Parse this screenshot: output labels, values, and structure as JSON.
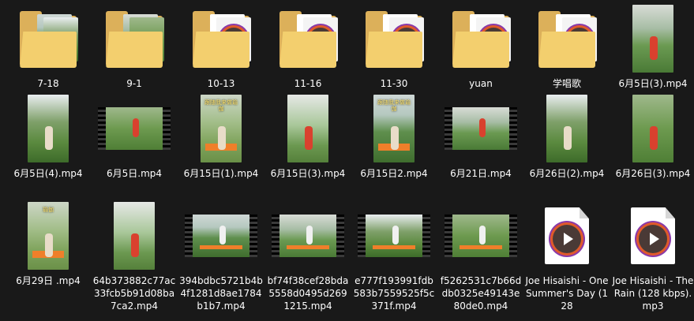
{
  "colors": {
    "background": "#191919",
    "folder": "#f3cf6e",
    "folder_back": "#dcb05a",
    "mat": "#ef7f2a",
    "play_ring_orange": "#e05a2a",
    "play_ring_purple": "#8a3aa8"
  },
  "files": [
    {
      "label": "7-18",
      "kind": "folder",
      "icon": "folder-icon"
    },
    {
      "label": "9-1",
      "kind": "folder",
      "icon": "folder-icon"
    },
    {
      "label": "10-13",
      "kind": "folder-video",
      "icon": "folder-icon"
    },
    {
      "label": "11-16",
      "kind": "folder-video",
      "icon": "folder-icon"
    },
    {
      "label": "11-30",
      "kind": "folder-video",
      "icon": "folder-icon"
    },
    {
      "label": "yuan",
      "kind": "folder-video",
      "icon": "folder-icon"
    },
    {
      "label": "学唱歌",
      "kind": "folder-video",
      "icon": "folder-icon"
    },
    {
      "label": "6月5日(3).mp4",
      "kind": "portrait",
      "icon": "video-thumbnail-icon"
    },
    {
      "label": "6月5日(4).mp4",
      "kind": "portrait",
      "icon": "video-thumbnail-icon"
    },
    {
      "label": "6月5日.mp4",
      "kind": "landscape",
      "icon": "video-thumbnail-icon"
    },
    {
      "label": "6月15日(1).mp4",
      "kind": "portrait",
      "icon": "video-thumbnail-icon",
      "overlay": "跟随我来做瑜伽"
    },
    {
      "label": "6月15日(3).mp4",
      "kind": "portrait",
      "icon": "video-thumbnail-icon"
    },
    {
      "label": "6月15日2.mp4",
      "kind": "portrait",
      "icon": "video-thumbnail-icon",
      "overlay": "跟随我来做瑜伽"
    },
    {
      "label": "6月21日.mp4",
      "kind": "landscape",
      "icon": "video-thumbnail-icon"
    },
    {
      "label": "6月26日(2).mp4",
      "kind": "portrait",
      "icon": "video-thumbnail-icon"
    },
    {
      "label": "6月26日(3).mp4",
      "kind": "portrait",
      "icon": "video-thumbnail-icon"
    },
    {
      "label": "6月29日 .mp4",
      "kind": "portrait",
      "icon": "video-thumbnail-icon",
      "overlay": "瑜伽"
    },
    {
      "label": "64b373882c77ac33fcb5b91d08ba7ca2.mp4",
      "kind": "portrait",
      "icon": "video-thumbnail-icon"
    },
    {
      "label": "394bdbc5721b4b4f1281d8ae1784b1b7.mp4",
      "kind": "landscape",
      "icon": "video-thumbnail-icon"
    },
    {
      "label": "bf74f38cef28bda5558d0495d2691215.mp4",
      "kind": "landscape",
      "icon": "video-thumbnail-icon"
    },
    {
      "label": "e777f193991fdb583b7559525f5c371f.mp4",
      "kind": "landscape",
      "icon": "video-thumbnail-icon"
    },
    {
      "label": "f5262531c7b66ddb0325e49143e80de0.mp4",
      "kind": "landscape",
      "icon": "video-thumbnail-icon"
    },
    {
      "label": "Joe Hisaishi - One Summer's Day (128",
      "kind": "audio",
      "icon": "media-player-icon"
    },
    {
      "label": "Joe Hisaishi - The Rain (128 kbps).mp3",
      "kind": "audio",
      "icon": "media-player-icon"
    }
  ]
}
